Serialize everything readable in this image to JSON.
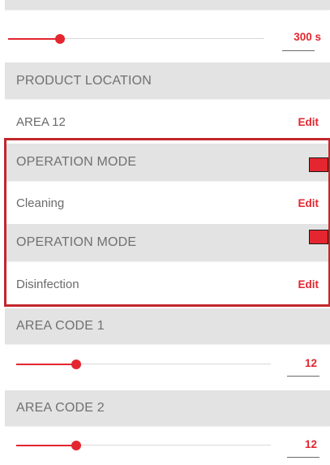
{
  "colors": {
    "accent": "#e3262f",
    "frame": "#c1272d",
    "header_bg": "#e3e3e3"
  },
  "sections": {
    "cleaning_time": {
      "value": "300 s",
      "slider_fraction": 0.2
    },
    "product_location": {
      "title": "PRODUCT LOCATION",
      "value": "AREA 12",
      "edit": "Edit"
    },
    "operation_mode_1": {
      "title": "OPERATION MODE",
      "value": "Cleaning",
      "edit": "Edit"
    },
    "operation_mode_2": {
      "title": "OPERATION MODE",
      "value": "Disinfection",
      "edit": "Edit"
    },
    "area_code_1": {
      "title": "AREA CODE 1",
      "value": "12",
      "slider_fraction": 0.22
    },
    "area_code_2": {
      "title": "AREA CODE 2",
      "value": "12",
      "slider_fraction": 0.22
    }
  }
}
